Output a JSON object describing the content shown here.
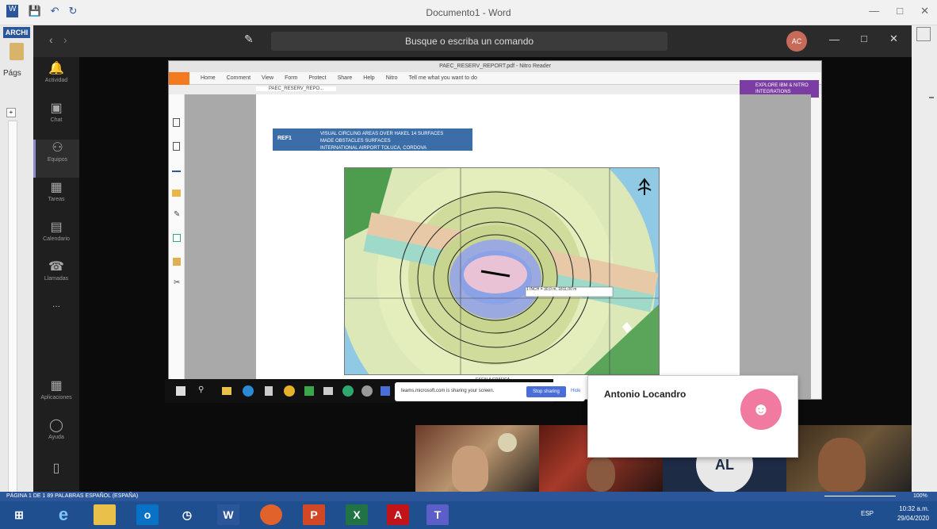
{
  "word": {
    "doc_title": "Documento1 - Word",
    "archi_label": "ARCHI",
    "page_label": "Págs",
    "status_left": "PÁGINA 1 DE 1    89 PALABRAS    ESPAÑOL (ESPAÑA)",
    "zoom": "100%"
  },
  "teams": {
    "search_placeholder": "Busque o escriba un comando",
    "user_initials": "AC",
    "rail": [
      {
        "icon": "bell-icon",
        "label": "Actividad"
      },
      {
        "icon": "chat-icon",
        "label": "Chat"
      },
      {
        "icon": "teams-icon",
        "label": "Equipos"
      },
      {
        "icon": "calendar-icon",
        "label": "Tareas"
      },
      {
        "icon": "meeting-icon",
        "label": "Calendario"
      },
      {
        "icon": "phone-icon",
        "label": "Llamadas"
      },
      {
        "icon": "more-icon",
        "label": "..."
      },
      {
        "icon": "apps-icon",
        "label": "Aplicaciones"
      },
      {
        "icon": "help-icon",
        "label": "Ayuda"
      }
    ]
  },
  "pdf": {
    "window_title": "PAEC_RESERV_REPORT.pdf - Nitro Reader",
    "ribbon_tabs": [
      "Home",
      "Comment",
      "View",
      "Form",
      "Protect",
      "Share",
      "Help",
      "Nitro",
      "Tell me what you want to do"
    ],
    "doc_tab": "PAEC_RESERV_REPO...",
    "promo": "EXPLORE IBM & NITRO INTEGRATIONS",
    "banner_code": "REF1",
    "banner_line1": "VISUAL CIRCLING AREAS OVER HAKEL 14 SURFACES",
    "banner_line2": "MADE OBSTACLES SURFACES",
    "banner_line3": "INTERNATIONAL AIRPORT TOLUCA, CORDOVA",
    "map_tooltip": "1 INCH = 30,0 m, 1811,00 m",
    "footer_caption": "ESCALA GRÁFICA"
  },
  "share": {
    "message": "teams.microsoft.com is sharing your screen.",
    "stop_label": "Stop sharing",
    "hide_label": "Hide"
  },
  "participant": {
    "name": "Antonio Locandro"
  },
  "taskbar": {
    "time": "10:32 a.m.",
    "date": "29/04/2020",
    "lang": "ESP"
  }
}
